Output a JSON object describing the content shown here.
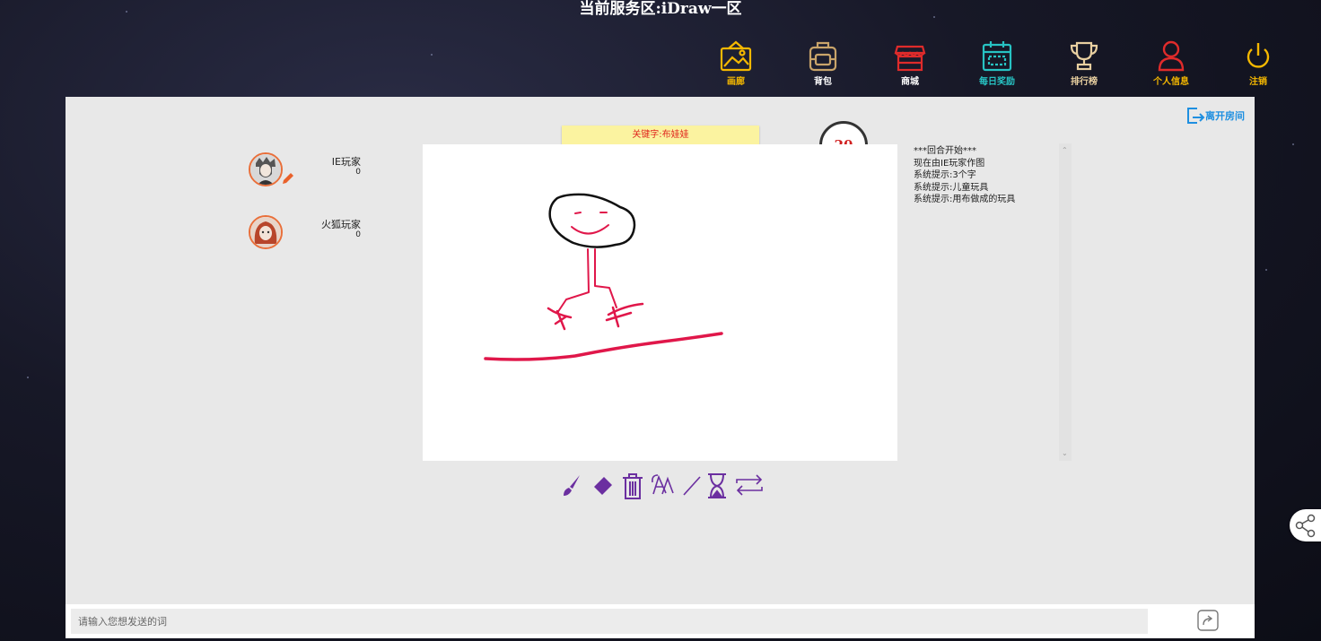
{
  "server": {
    "title": "当前服务区:iDraw一区"
  },
  "nav": [
    {
      "label": "画廊",
      "icon": "gallery-icon",
      "color": "#f5b800"
    },
    {
      "label": "背包",
      "icon": "backpack-icon",
      "color": "#c9a46a"
    },
    {
      "label": "商城",
      "icon": "shop-icon",
      "color": "#e02b2b"
    },
    {
      "label": "每日奖励",
      "icon": "calendar-icon",
      "color": "#27c3c3"
    },
    {
      "label": "排行榜",
      "icon": "trophy-icon",
      "color": "#e8cfa0"
    },
    {
      "label": "个人信息",
      "icon": "user-icon",
      "color": "#e02b2b"
    },
    {
      "label": "注销",
      "icon": "power-icon",
      "color": "#f5b800"
    }
  ],
  "room": {
    "leave_label": "离开房间"
  },
  "players": [
    {
      "name": "IE玩家",
      "score": "0",
      "drawing": true
    },
    {
      "name": "火狐玩家",
      "score": "0",
      "drawing": false
    }
  ],
  "game": {
    "keyword": "关键字:布娃娃",
    "timer": "20"
  },
  "log": [
    "***回合开始***",
    "现在由IE玩家作图",
    "系统提示:3个字",
    "系统提示:儿童玩具",
    "系统提示:用布做成的玩具"
  ],
  "tools": [
    {
      "icon": "brush-icon"
    },
    {
      "icon": "eraser-icon"
    },
    {
      "icon": "trash-icon"
    },
    {
      "icon": "fill-icon"
    },
    {
      "icon": "line-icon"
    },
    {
      "icon": "hourglass-icon"
    },
    {
      "icon": "swap-icon"
    }
  ],
  "chat": {
    "placeholder": "请输入您想发送的词"
  },
  "colors": {
    "accent": "#6b2fa0",
    "panel": "#e8e8e8",
    "link": "#1e8fe0"
  }
}
